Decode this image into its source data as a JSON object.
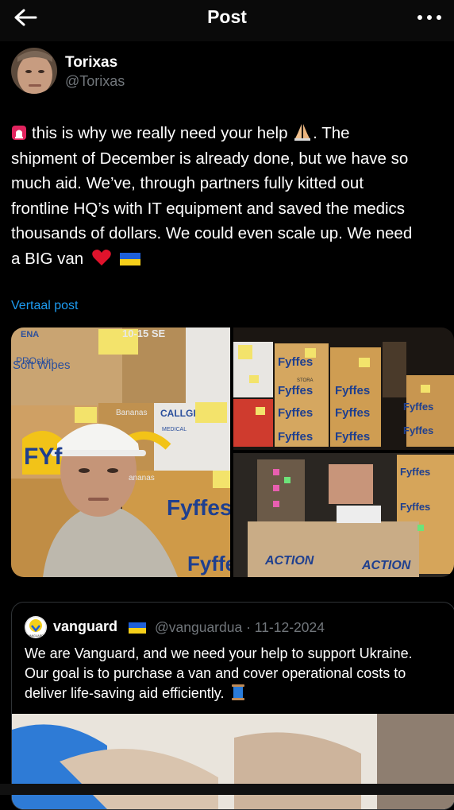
{
  "header": {
    "title": "Post"
  },
  "author": {
    "name": "Torixas",
    "handle": "@Torixas"
  },
  "post": {
    "line1a": "this is why we really need your help",
    "line1b": ".  The",
    "line2": "shipment of December is already done, but we have so",
    "line3": "much aid. We’ve, through partners fully kitted out",
    "line4": "frontline HQ’s with IT equipment and saved the medics",
    "line5": "thousands of dollars. We could even scale up. We need",
    "line6": "a BIG van",
    "translate": "Vertaal post"
  },
  "photos": {
    "wipes_brand": "PROskin",
    "wipes": "Soft Wipes",
    "bananas": "Bananas",
    "bananas2": "ananas",
    "calligen": "CALLGI",
    "medical": "MEDICAL",
    "fyffes": "Fyffes",
    "fyf": "FYf",
    "fyffe": "Fyffe",
    "action": "ACTION",
    "stora": "STORA",
    "ena": "ENA",
    "ten": "10-15 SE"
  },
  "quote": {
    "name": "vanguard",
    "meta": "@vanguardua · 11-12-2024",
    "text": "We are Vanguard, and we need your help to support Ukraine. Our goal is to purchase a van and cover operational costs to deliver life-saving aid efficiently.",
    "logo_text": "VANGUARD"
  },
  "colors": {
    "accent": "#1d9bf0",
    "background": "#000000",
    "secondary": "#71767b"
  },
  "icons": [
    "back-arrow-icon",
    "more-dots-icon",
    "siren-emoji",
    "praying-hands-emoji",
    "red-heart-emoji",
    "ukraine-flag-emoji",
    "spool-emoji"
  ]
}
